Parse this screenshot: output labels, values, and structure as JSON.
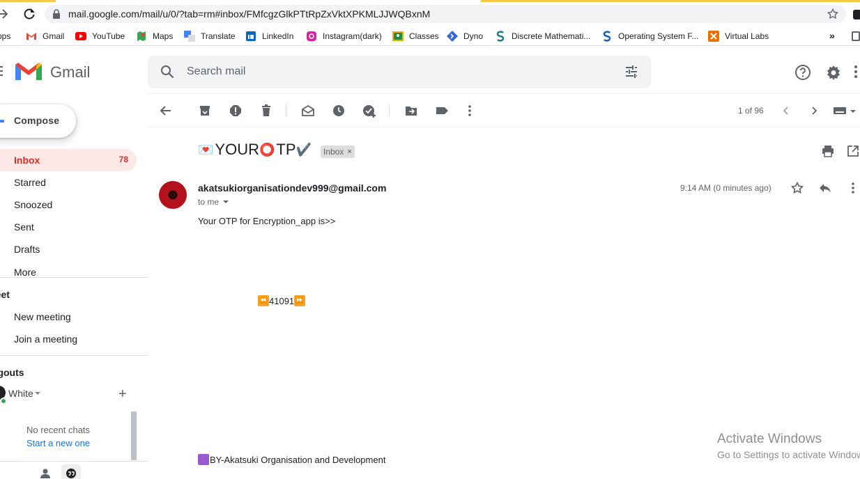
{
  "browser": {
    "url": "mail.google.com/mail/u/0/?tab=rm#inbox/FMfcgzGlkPTtRpZxVktXPKMLJJWQBxnM",
    "bookmarks": [
      {
        "label": "Apps",
        "icon": "apps-grid-icon"
      },
      {
        "label": "Gmail",
        "icon": "gmail-icon"
      },
      {
        "label": "YouTube",
        "icon": "youtube-icon"
      },
      {
        "label": "Maps",
        "icon": "maps-icon"
      },
      {
        "label": "Translate",
        "icon": "translate-icon"
      },
      {
        "label": "LinkedIn",
        "icon": "linkedin-icon"
      },
      {
        "label": "Instagram(dark)",
        "icon": "instagram-icon"
      },
      {
        "label": "Classes",
        "icon": "classroom-icon"
      },
      {
        "label": "Dyno",
        "icon": "dyno-icon"
      },
      {
        "label": "Discrete Mathemati...",
        "icon": "scribd-icon"
      },
      {
        "label": "Operating System F...",
        "icon": "scribd-icon"
      },
      {
        "label": "Virtual Labs",
        "icon": "virtual-labs-icon"
      }
    ],
    "more": "»"
  },
  "gmail": {
    "brand": "Gmail",
    "search_placeholder": "Search mail"
  },
  "sidebar": {
    "compose": "Compose",
    "items": [
      {
        "label": "Inbox",
        "count": "78"
      },
      {
        "label": "Starred",
        "count": ""
      },
      {
        "label": "Snoozed",
        "count": ""
      },
      {
        "label": "Sent",
        "count": ""
      },
      {
        "label": "Drafts",
        "count": ""
      },
      {
        "label": "More",
        "count": ""
      }
    ],
    "meet": {
      "title": "Meet",
      "new_meeting": "New meeting",
      "join_meeting": "Join a meeting"
    },
    "hangouts": {
      "title": "Hangouts",
      "user": "White",
      "no_chats": "No recent chats",
      "start_new": "Start a new one"
    }
  },
  "toolbar": {
    "pager": "1 of 96"
  },
  "message": {
    "subject_text_1": "YOUR ",
    "subject_text_2": "TP",
    "subject_emoji_1": "💌",
    "subject_emoji_2": "⭕",
    "subject_emoji_3": "✔️",
    "label": "Inbox",
    "label_close": "×",
    "sender": "akatsukiorganisationdev999@gmail.com",
    "to": "to me",
    "time": "9:14 AM (0 minutes ago)",
    "body": "Your OTP for Encryption_app is>>",
    "otp": "41091",
    "otp_prefix": "⏪",
    "otp_suffix": "⏩",
    "signature": "BY-Akatsuki Organisation and Development"
  },
  "watermark": {
    "title": "Activate Windows",
    "subtitle": "Go to Settings to activate Windows."
  },
  "colors": {
    "accent_red": "#d93025",
    "inbox_bg": "#fce8e6",
    "link_blue": "#1a73e8",
    "presence_green": "#34a853"
  }
}
